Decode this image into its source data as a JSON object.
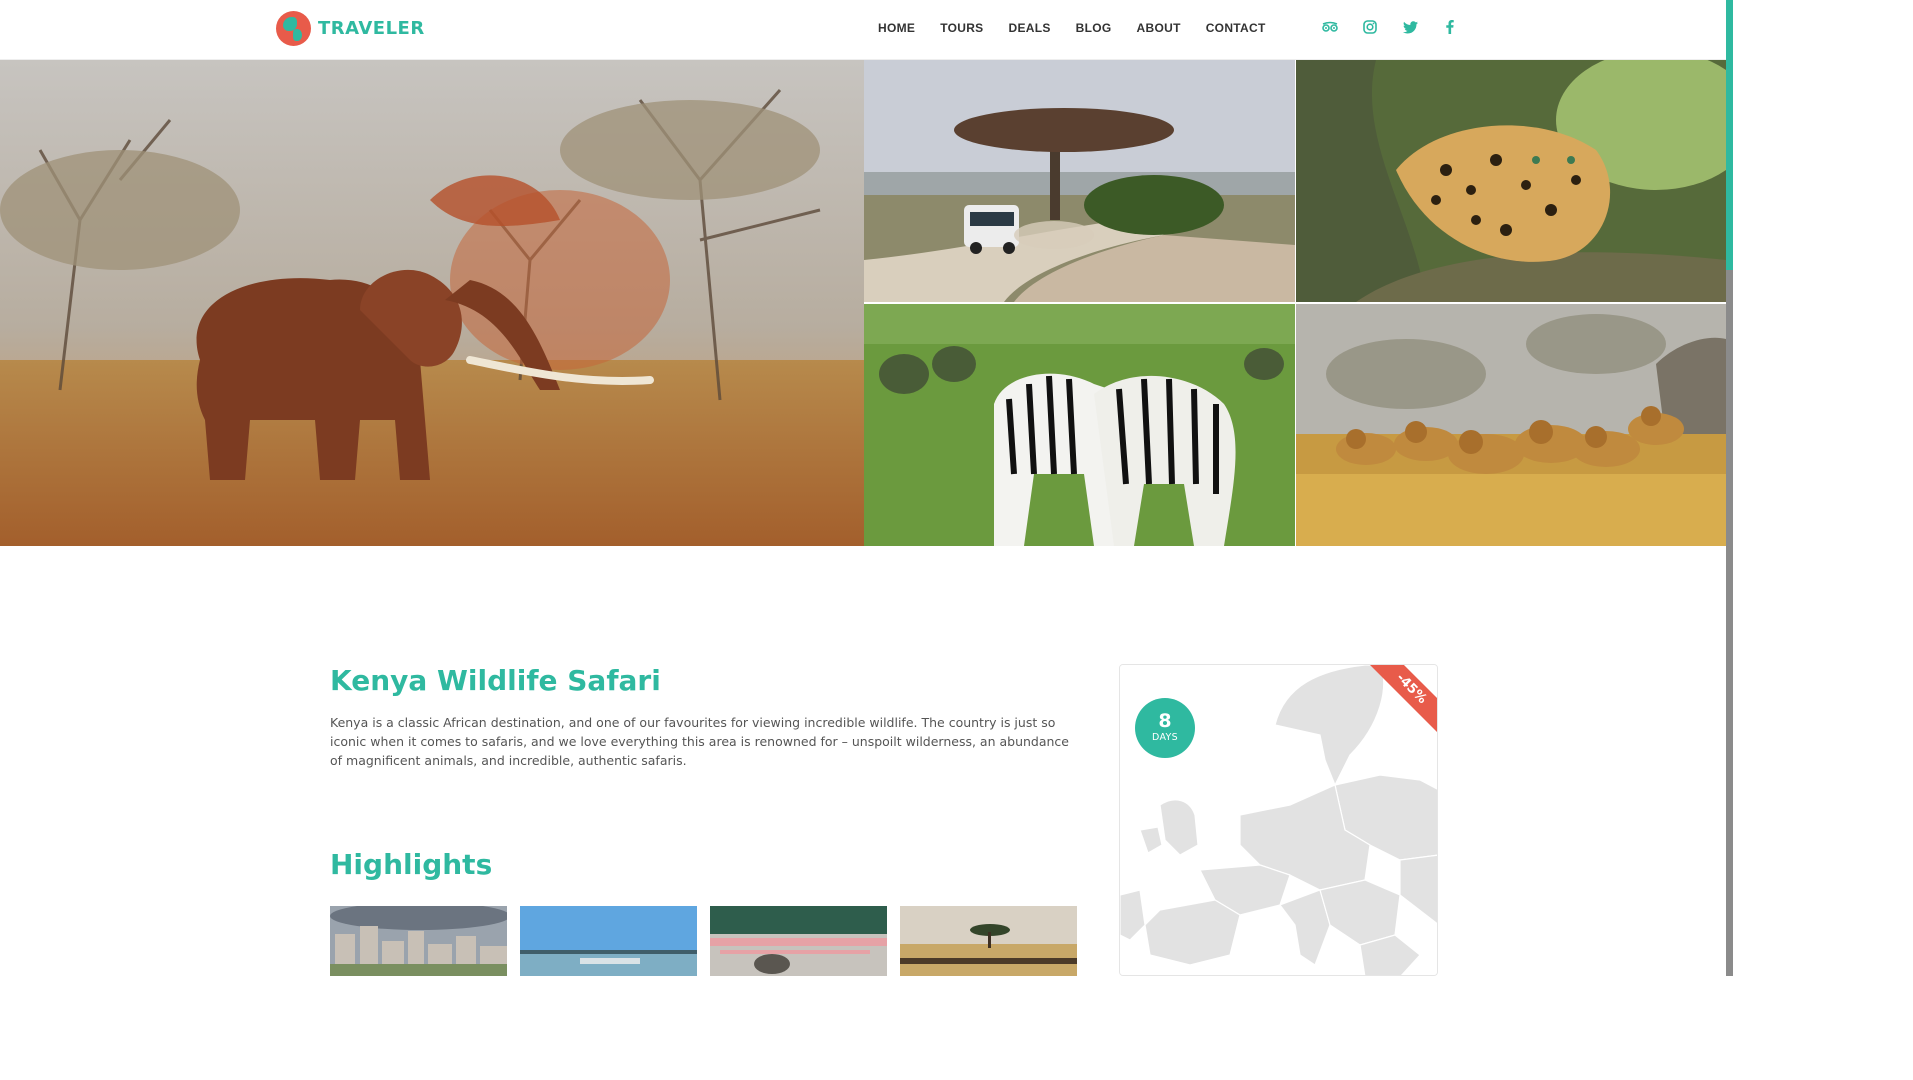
{
  "brand": {
    "name": "TRAVELER",
    "primary_color": "#2fb9a0",
    "accent_color": "#e85b4a"
  },
  "nav": {
    "items": [
      "HOME",
      "TOURS",
      "DEALS",
      "BLOG",
      "ABOUT",
      "CONTACT"
    ]
  },
  "social": [
    {
      "icon": "tripadvisor-icon",
      "glyph": "◎"
    },
    {
      "icon": "instagram-icon",
      "glyph": "◻"
    },
    {
      "icon": "twitter-icon",
      "glyph": "🐦"
    },
    {
      "icon": "facebook-icon",
      "glyph": "f"
    }
  ],
  "gallery": [
    {
      "name": "elephant-photo",
      "subject": "elephant"
    },
    {
      "name": "safari-jeep-photo",
      "subject": "safari vehicle"
    },
    {
      "name": "leopard-photo",
      "subject": "leopard"
    },
    {
      "name": "zebra-photo",
      "subject": "zebras"
    },
    {
      "name": "lions-photo",
      "subject": "lions"
    }
  ],
  "tour": {
    "title": "Kenya Wildlife Safari",
    "description": "Kenya is a classic African destination, and one of our favourites for viewing incredible wildlife. The country is just so iconic when it comes to safaris, and we love everything this area is renowned for – unspoilt wilderness, an abundance of magnificent animals, and incredible, authentic safaris."
  },
  "highlights": {
    "title": "Highlights",
    "thumbs": [
      "city-thumb",
      "lake-thumb",
      "flamingo-thumb",
      "savanna-thumb"
    ]
  },
  "map_card": {
    "discount": "-45%",
    "days_number": "8",
    "days_label": "DAYS"
  }
}
